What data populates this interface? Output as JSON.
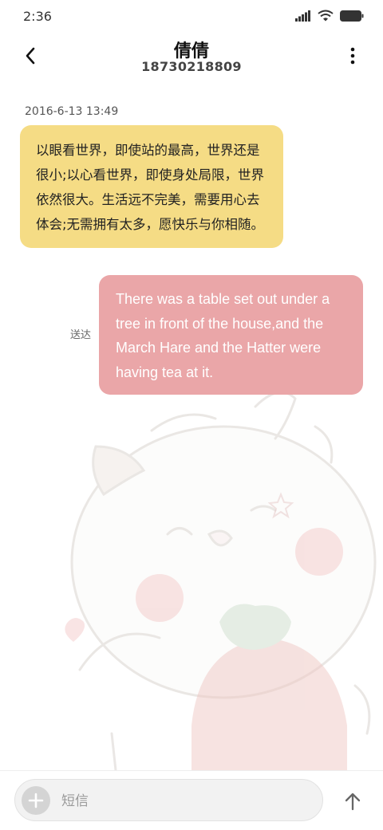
{
  "status_bar": {
    "time": "2:36",
    "icons": [
      "signal-icon",
      "wifi-icon",
      "battery-icon"
    ]
  },
  "header": {
    "contact_name": "倩倩",
    "phone_number": "18730218809",
    "icons": [
      "back-arrow-icon",
      "more-vertical-icon"
    ]
  },
  "conversation": {
    "timestamp": "2016-6-13 13:49",
    "incoming_message": "以眼看世界，即使站的最高，世界还是很小;以心看世界，即使身处局限，世界依然很大。生活远不完美，需要用心去体会;无需拥有太多，愿快乐与你相随。",
    "outgoing_message": "There was a table set out under a tree in front of the house,and the March Hare and the Hatter were having tea at it.",
    "outgoing_status": "送达"
  },
  "composer": {
    "placeholder": "短信",
    "icons": [
      "add-icon",
      "send-arrow-icon"
    ]
  },
  "colors": {
    "incoming_bubble": "#f5dc85",
    "outgoing_bubble": "#eaa6a8",
    "background": "#ffffff"
  }
}
